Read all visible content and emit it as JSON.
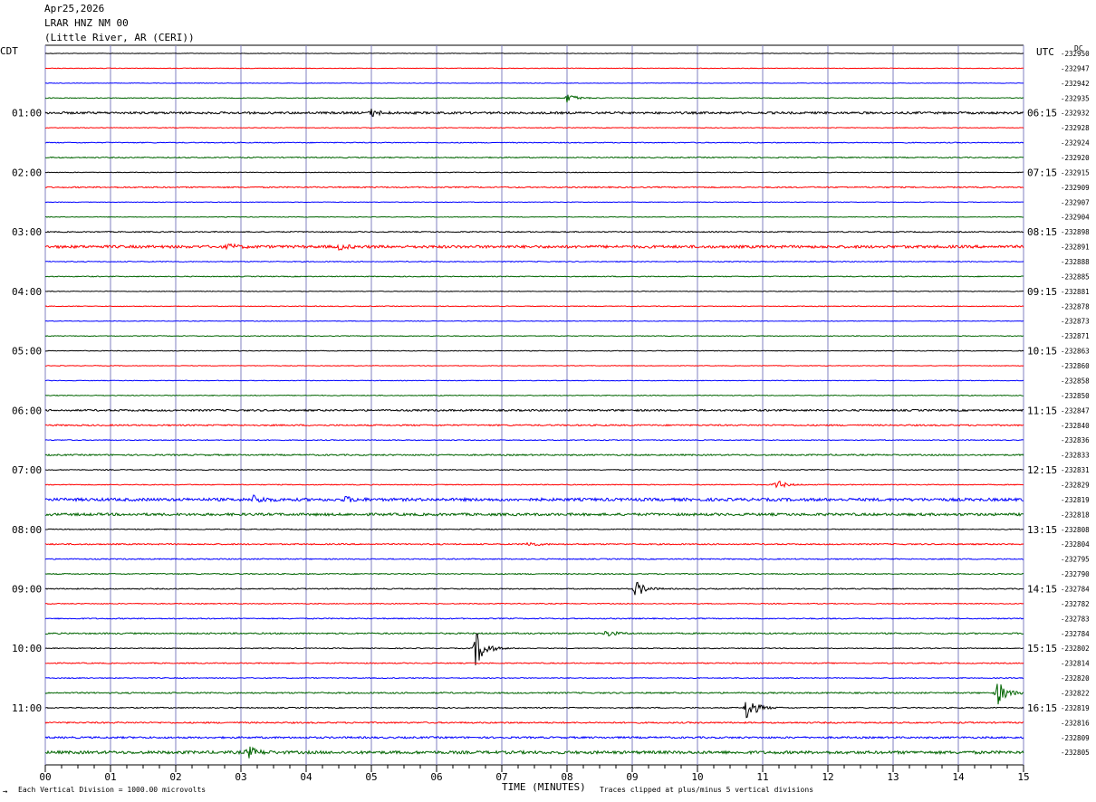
{
  "header": {
    "date": "Apr25,2026",
    "station": "LRAR HNZ NM 00",
    "location": "(Little River, AR (CERI))"
  },
  "left_timezone": "CDT",
  "right_timezone": "UTC",
  "dc_label": "DC",
  "footer": {
    "left_note": "Each Vertical Division = 1000.00 microvolts",
    "xlabel": "TIME (MINUTES)",
    "right_note": "Traces clipped at plus/minus 5 vertical divisions",
    "logo_mark": "→"
  },
  "colors": {
    "black": "#000000",
    "red": "#ff0000",
    "blue": "#0000ff",
    "green": "#006400",
    "grid": "#8080c0"
  },
  "chart_data": {
    "type": "line",
    "title": "",
    "xlabel": "TIME (MINUTES)",
    "ylabel": "",
    "xlim": [
      0,
      15
    ],
    "x_ticks": [
      "00",
      "01",
      "02",
      "03",
      "04",
      "05",
      "06",
      "07",
      "08",
      "09",
      "10",
      "11",
      "12",
      "13",
      "14",
      "15"
    ],
    "trace_color_cycle": [
      "black",
      "red",
      "blue",
      "green"
    ],
    "hour_labels_left": [
      "01:00",
      "02:00",
      "03:00",
      "04:00",
      "05:00",
      "06:00",
      "07:00",
      "08:00",
      "09:00",
      "10:00",
      "11:00"
    ],
    "hour_labels_right": [
      "06:15",
      "07:15",
      "08:15",
      "09:15",
      "10:15",
      "11:15",
      "12:15",
      "13:15",
      "14:15",
      "15:15",
      "16:15"
    ],
    "dc_offsets": [
      "-232950",
      "-232947",
      "-232942",
      "-232935",
      "-232932",
      "-232928",
      "-232924",
      "-232920",
      "-232915",
      "-232909",
      "-232907",
      "-232904",
      "-232898",
      "-232891",
      "-232888",
      "-232885",
      "-232881",
      "-232878",
      "-232873",
      "-232871",
      "-232863",
      "-232860",
      "-232858",
      "-232850",
      "-232847",
      "-232840",
      "-232836",
      "-232833",
      "-232831",
      "-232829",
      "-232819",
      "-232818",
      "-232808",
      "-232804",
      "-232795",
      "-232790",
      "-232784",
      "-232782",
      "-232783",
      "-232784",
      "-232802",
      "-232814",
      "-232820",
      "-232822",
      "-232819",
      "-232816",
      "-232809",
      "-232805"
    ],
    "trace_noise": [
      0.3,
      0.35,
      0.3,
      0.45,
      1.2,
      0.4,
      0.5,
      0.6,
      0.4,
      0.7,
      0.35,
      0.35,
      0.6,
      1.5,
      0.5,
      0.5,
      0.35,
      0.4,
      0.35,
      0.4,
      0.4,
      0.35,
      0.35,
      0.45,
      1.0,
      0.8,
      0.5,
      0.8,
      0.5,
      0.5,
      1.6,
      1.4,
      0.5,
      0.7,
      0.6,
      0.6,
      0.6,
      0.5,
      0.6,
      0.8,
      0.5,
      0.6,
      0.5,
      0.8,
      0.6,
      0.8,
      1.0,
      1.6
    ],
    "events": [
      {
        "trace": 3,
        "minute": 8.0,
        "amplitude": 5
      },
      {
        "trace": 4,
        "minute": 5.0,
        "amplitude": 4
      },
      {
        "trace": 13,
        "minute": 2.8,
        "amplitude": 3
      },
      {
        "trace": 13,
        "minute": 4.5,
        "amplitude": 3
      },
      {
        "trace": 29,
        "minute": 11.2,
        "amplitude": 6
      },
      {
        "trace": 30,
        "minute": 3.2,
        "amplitude": 5
      },
      {
        "trace": 30,
        "minute": 4.6,
        "amplitude": 3
      },
      {
        "trace": 33,
        "minute": 7.4,
        "amplitude": 3
      },
      {
        "trace": 36,
        "minute": 9.05,
        "amplitude": 10
      },
      {
        "trace": 39,
        "minute": 8.6,
        "amplitude": 4
      },
      {
        "trace": 40,
        "minute": 6.6,
        "amplitude": 22
      },
      {
        "trace": 43,
        "minute": 14.6,
        "amplitude": 14
      },
      {
        "trace": 44,
        "minute": 10.75,
        "amplitude": 16
      },
      {
        "trace": 47,
        "minute": 3.1,
        "amplitude": 7
      }
    ]
  }
}
